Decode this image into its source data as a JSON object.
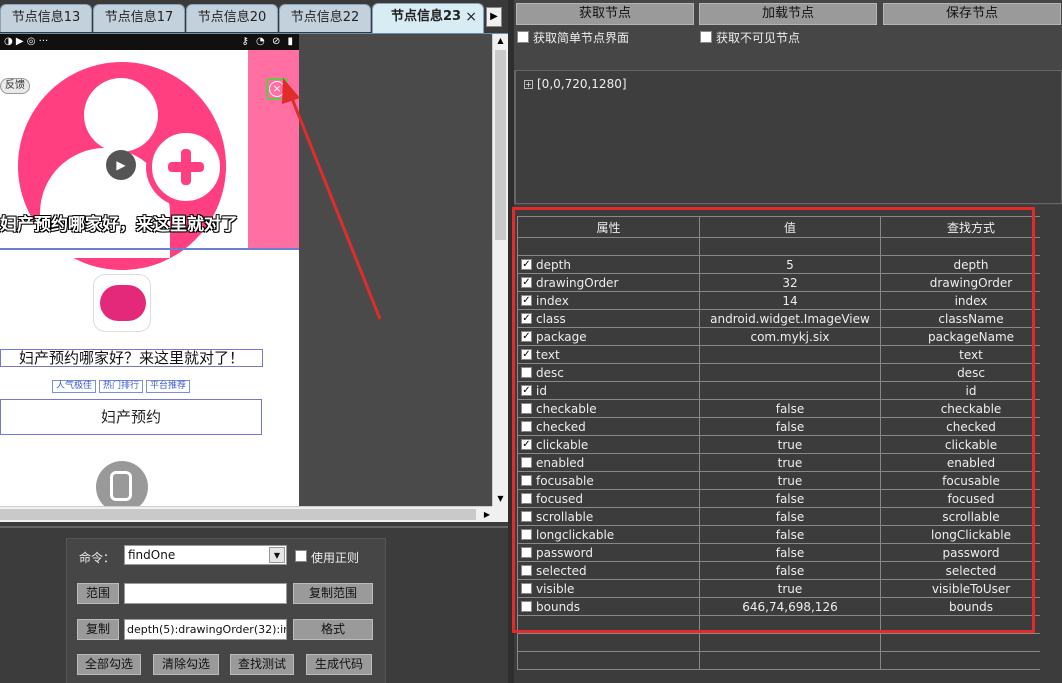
{
  "tabs": [
    {
      "label": "节点信息13",
      "active": false
    },
    {
      "label": "节点信息17",
      "active": false
    },
    {
      "label": "节点信息20",
      "active": false
    },
    {
      "label": "节点信息22",
      "active": false
    },
    {
      "label": "节点信息23",
      "active": true
    }
  ],
  "tab_close": "×",
  "tab_scroll": "▶",
  "phone": {
    "ad_tag": "反馈",
    "ad_caption": "妇产预约哪家好，来这里就对了",
    "app_title": "妇产预约哪家好？来这里就对了！",
    "chips": [
      "人气极佳",
      "热门排行",
      "平台推荐"
    ],
    "main_button": "妇产预约",
    "close_glyph": "×",
    "play_glyph": "▶"
  },
  "toolbar": {
    "get_nodes": "获取节点",
    "load_nodes": "加载节点",
    "save_nodes": "保存节点",
    "simple_ui": "获取简单节点界面",
    "invisible": "获取不可见节点"
  },
  "tree": {
    "expander": "+",
    "root": "[0,0,720,1280]"
  },
  "command": {
    "label": "命令：",
    "value": "findOne",
    "regex_label": "使用正则",
    "range_button": "范围",
    "range_value": "",
    "copy_range_button": "复制范围",
    "copy_button": "复制",
    "copy_value": "depth(5):drawingOrder(32):inde",
    "format_button": "格式",
    "select_all": "全部勾选",
    "clear_all": "清除勾选",
    "test_find": "查找测试",
    "gen_code": "生成代码"
  },
  "grid": {
    "headers": [
      "属性",
      "值",
      "查找方式"
    ],
    "rows": [
      {
        "name": "depth",
        "checked": true,
        "value": "5",
        "method": "depth"
      },
      {
        "name": "drawingOrder",
        "checked": true,
        "value": "32",
        "method": "drawingOrder"
      },
      {
        "name": "index",
        "checked": true,
        "value": "14",
        "method": "index"
      },
      {
        "name": "class",
        "checked": true,
        "value": "android.widget.ImageView",
        "method": "className"
      },
      {
        "name": "package",
        "checked": true,
        "value": "com.mykj.six",
        "method": "packageName"
      },
      {
        "name": "text",
        "checked": true,
        "value": "",
        "method": "text"
      },
      {
        "name": "desc",
        "checked": false,
        "value": "",
        "method": "desc"
      },
      {
        "name": "id",
        "checked": true,
        "value": "",
        "method": "id"
      },
      {
        "name": "checkable",
        "checked": false,
        "value": "false",
        "method": "checkable"
      },
      {
        "name": "checked",
        "checked": false,
        "value": "false",
        "method": "checked"
      },
      {
        "name": "clickable",
        "checked": true,
        "value": "true",
        "method": "clickable"
      },
      {
        "name": "enabled",
        "checked": false,
        "value": "true",
        "method": "enabled"
      },
      {
        "name": "focusable",
        "checked": false,
        "value": "true",
        "method": "focusable"
      },
      {
        "name": "focused",
        "checked": false,
        "value": "false",
        "method": "focused"
      },
      {
        "name": "scrollable",
        "checked": false,
        "value": "false",
        "method": "scrollable"
      },
      {
        "name": "longclickable",
        "checked": false,
        "value": "false",
        "method": "longClickable"
      },
      {
        "name": "password",
        "checked": false,
        "value": "false",
        "method": "password"
      },
      {
        "name": "selected",
        "checked": false,
        "value": "false",
        "method": "selected"
      },
      {
        "name": "visible",
        "checked": false,
        "value": "true",
        "method": "visibleToUser"
      },
      {
        "name": "bounds",
        "checked": false,
        "value": "646,74,698,126",
        "method": "bounds"
      }
    ]
  },
  "colors": {
    "highlight": "#e22b2b",
    "accent_pink": "#ff3f7f"
  }
}
